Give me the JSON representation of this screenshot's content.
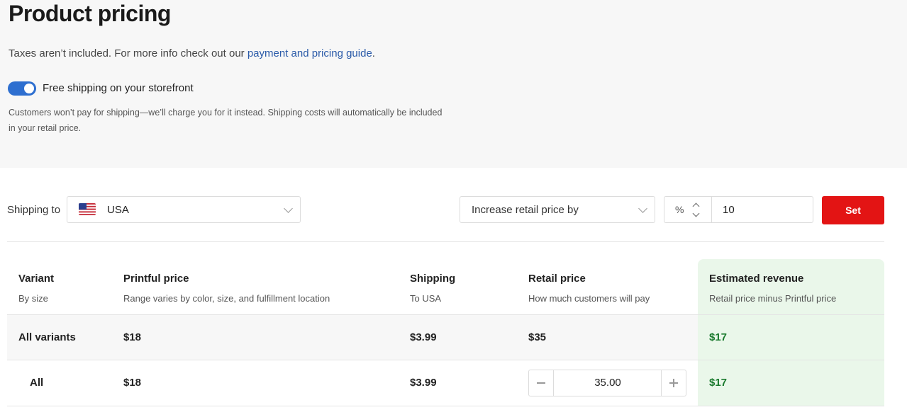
{
  "page": {
    "title": "Product pricing",
    "taxes_prefix": "Taxes aren’t included. For more info check out our ",
    "taxes_link": "payment and pricing guide",
    "taxes_suffix": ".",
    "free_shipping": {
      "label": "Free shipping on your storefront",
      "enabled": true,
      "note": "Customers won’t pay for shipping—we’ll charge you for it instead. Shipping costs will automatically be included in your retail price."
    }
  },
  "controls": {
    "shipping_to_label": "Shipping to",
    "country": "USA",
    "price_mode": "Increase retail price by",
    "unit": "%",
    "amount": "10",
    "set_label": "Set"
  },
  "table": {
    "headers": [
      {
        "title": "Variant",
        "sub": "By size"
      },
      {
        "title": "Printful price",
        "sub": "Range varies by color, size, and fulfillment location"
      },
      {
        "title": "Shipping",
        "sub": "To USA"
      },
      {
        "title": "Retail price",
        "sub": "How much customers will pay"
      },
      {
        "title": "Estimated revenue",
        "sub": "Retail price minus Printful price"
      }
    ],
    "rows": [
      {
        "variant": "All variants",
        "printful": "$18",
        "shipping": "$3.99",
        "retail": "$35",
        "revenue": "$17"
      },
      {
        "variant": "All",
        "printful": "$18",
        "shipping": "$3.99",
        "retail": "35.00",
        "revenue": "$17"
      }
    ]
  },
  "colors": {
    "accent": "#2e6fd0",
    "set_button": "#e31414",
    "revenue_bg": "#eaf7ea",
    "revenue_text": "#1a7a2e"
  }
}
